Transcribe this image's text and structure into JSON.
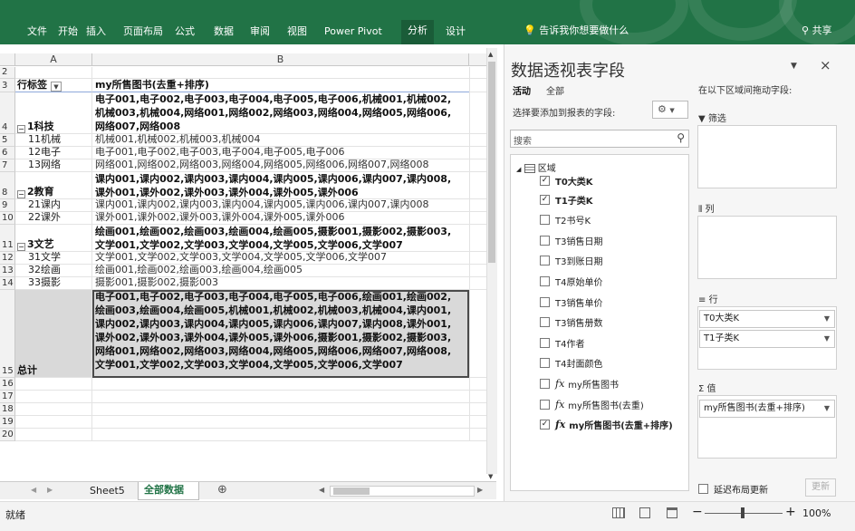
{
  "ribbon": {
    "tabs": [
      "文件",
      "开始",
      "插入",
      "页面布局",
      "公式",
      "数据",
      "审阅",
      "视图",
      "Power Pivot",
      "分析",
      "设计"
    ],
    "tell_me": "告诉我你想要做什么",
    "share": "共享"
  },
  "sheet": {
    "columns": [
      "A",
      "B"
    ],
    "header": {
      "a": "行标签",
      "b": "my所售图书(去重+排序)"
    },
    "rows": [
      {
        "n": "2",
        "a": "",
        "b": ""
      },
      {
        "n": "4",
        "a": "1科技",
        "b": "电子001,电子002,电子003,电子004,电子005,电子006,机械001,机械002,\n机械003,机械004,网络001,网络002,网络003,网络004,网络005,网络006,\n网络007,网络008"
      },
      {
        "n": "5",
        "a": "11机械",
        "b": "机械001,机械002,机械003,机械004"
      },
      {
        "n": "6",
        "a": "12电子",
        "b": "电子001,电子002,电子003,电子004,电子005,电子006"
      },
      {
        "n": "7",
        "a": "13网络",
        "b": "网络001,网络002,网络003,网络004,网络005,网络006,网络007,网络008"
      },
      {
        "n": "8",
        "a": "2教育",
        "b": "课内001,课内002,课内003,课内004,课内005,课内006,课内007,课内008,\n课外001,课外002,课外003,课外004,课外005,课外006"
      },
      {
        "n": "9",
        "a": "21课内",
        "b": "课内001,课内002,课内003,课内004,课内005,课内006,课内007,课内008"
      },
      {
        "n": "10",
        "a": "22课外",
        "b": "课外001,课外002,课外003,课外004,课外005,课外006"
      },
      {
        "n": "11",
        "a": "3文艺",
        "b": "绘画001,绘画002,绘画003,绘画004,绘画005,摄影001,摄影002,摄影003,\n文学001,文学002,文学003,文学004,文学005,文学006,文学007"
      },
      {
        "n": "12",
        "a": "31文学",
        "b": "文学001,文学002,文学003,文学004,文学005,文学006,文学007"
      },
      {
        "n": "13",
        "a": "32绘画",
        "b": "绘画001,绘画002,绘画003,绘画004,绘画005"
      },
      {
        "n": "14",
        "a": "33摄影",
        "b": "摄影001,摄影002,摄影003"
      },
      {
        "n": "15",
        "a": "总计",
        "b": "电子001,电子002,电子003,电子004,电子005,电子006,绘画001,绘画002,\n绘画003,绘画004,绘画005,机械001,机械002,机械003,机械004,课内001,\n课内002,课内003,课内004,课内005,课内006,课内007,课内008,课外001,\n课外002,课外003,课外004,课外005,课外006,摄影001,摄影002,摄影003,\n网络001,网络002,网络003,网络004,网络005,网络006,网络007,网络008,\n文学001,文学002,文学003,文学004,文学005,文学006,文学007"
      },
      {
        "n": "16",
        "a": "",
        "b": ""
      },
      {
        "n": "17",
        "a": "",
        "b": ""
      },
      {
        "n": "18",
        "a": "",
        "b": ""
      },
      {
        "n": "19",
        "a": "",
        "b": ""
      },
      {
        "n": "20",
        "a": "",
        "b": ""
      }
    ],
    "header_row_num": "3",
    "tabs": [
      "Sheet5",
      "全部数据"
    ],
    "add_sheet": "⊕"
  },
  "status": {
    "ready": "就绪",
    "zoom": "100%"
  },
  "pivot_pane": {
    "title": "数据透视表字段",
    "tab_active": "活动",
    "tab_all": "全部",
    "choose_label": "选择要添加到报表的字段:",
    "search_placeholder": "搜索",
    "table_name": "区域",
    "fields": [
      {
        "label": "T0大类K",
        "checked": true,
        "fx": false
      },
      {
        "label": "T1子类K",
        "checked": true,
        "fx": false
      },
      {
        "label": "T2书号K",
        "checked": false,
        "fx": false
      },
      {
        "label": "T3销售日期",
        "checked": false,
        "fx": false
      },
      {
        "label": "T3到账日期",
        "checked": false,
        "fx": false
      },
      {
        "label": "T4原始单价",
        "checked": false,
        "fx": false
      },
      {
        "label": "T3销售单价",
        "checked": false,
        "fx": false
      },
      {
        "label": "T3销售册数",
        "checked": false,
        "fx": false
      },
      {
        "label": "T4作者",
        "checked": false,
        "fx": false
      },
      {
        "label": "T4封面颜色",
        "checked": false,
        "fx": false
      },
      {
        "label": "my所售图书",
        "checked": false,
        "fx": true
      },
      {
        "label": "my所售图书(去重)",
        "checked": false,
        "fx": true
      },
      {
        "label": "my所售图书(去重+排序)",
        "checked": true,
        "fx": true
      }
    ],
    "drag_label": "在以下区域间拖动字段:",
    "filter_label": "筛选",
    "columns_label": "列",
    "rows_label": "行",
    "values_label": "值",
    "rows_items": [
      "T0大类K",
      "T1子类K"
    ],
    "values_items": [
      "my所售图书(去重+排序)"
    ],
    "defer_label": "延迟布局更新",
    "update_label": "更新"
  }
}
